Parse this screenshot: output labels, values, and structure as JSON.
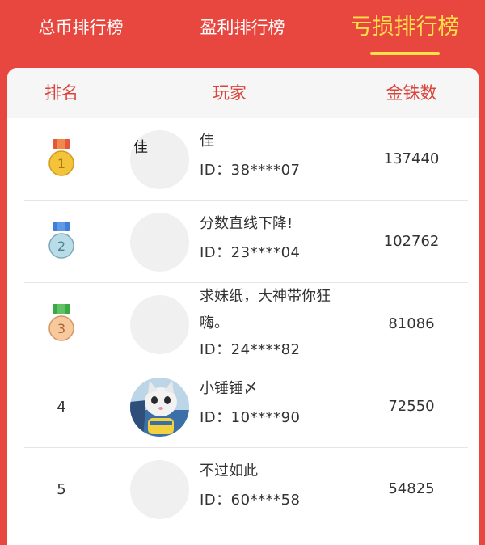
{
  "tabs": [
    {
      "label": "总币排行榜",
      "active": false
    },
    {
      "label": "盈利排行榜",
      "active": false
    },
    {
      "label": "亏损排行榜",
      "active": true
    }
  ],
  "colors": {
    "background": "#e8473f",
    "active_tab": "#ffe04a",
    "header_text": "#d9453b",
    "gold_medal": "#f3c33a",
    "silver_medal": "#b9dde8",
    "bronze_medal": "#f7c99d"
  },
  "table": {
    "headers": {
      "rank": "排名",
      "player": "玩家",
      "coins": "金铢数"
    },
    "rows": [
      {
        "rank": "1",
        "medal": "gold-medal-icon",
        "avatar_text": "佳",
        "name": "佳",
        "id": "ID：38****07",
        "coins": "137440"
      },
      {
        "rank": "2",
        "medal": "silver-medal-icon",
        "avatar_text": "",
        "name": "分数直线下降!",
        "id": "ID：23****04",
        "coins": "102762"
      },
      {
        "rank": "3",
        "medal": "bronze-medal-icon",
        "avatar_text": "",
        "name_line1": "求妹纸，大神带你狂",
        "name_line2": "嗨。",
        "id": "ID：24****82",
        "coins": "81086"
      },
      {
        "rank": "4",
        "medal": "",
        "avatar_text": "",
        "avatar_icon": "cat-photo-avatar",
        "name": "小锤锤〆",
        "id": "ID：10****90",
        "coins": "72550"
      },
      {
        "rank": "5",
        "medal": "",
        "avatar_text": "",
        "name": "不过如此",
        "id": "ID：60****58",
        "coins": "54825"
      }
    ]
  }
}
